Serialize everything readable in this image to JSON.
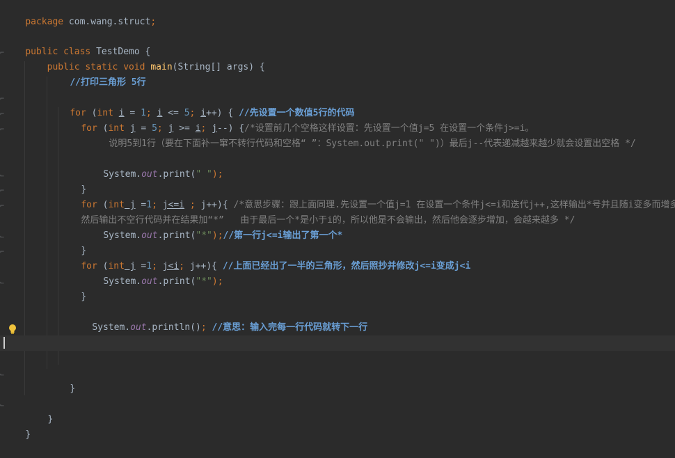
{
  "code": {
    "l1_package": "package",
    "l1_name": " com.wang.struct",
    "l1_semi": ";",
    "l3_public": "public",
    "l3_class": " class",
    "l3_name": " TestDemo {",
    "l4_indent": "    ",
    "l4_mods": "public static void",
    "l4_main": " main",
    "l4_args": "(String[] args) {",
    "l5_comment": "//打印三角形 5行",
    "l7_for": "for",
    "l7_a": " (",
    "l7_int": "int",
    "l7_i1": "i",
    "l7_eq": " = ",
    "l7_n1": "1",
    "l7_semi1": "; ",
    "l7_i2": "i",
    "l7_le": " <= ",
    "l7_n5": "5",
    "l7_semi2": "; ",
    "l7_i3": "i",
    "l7_inc": "++) { ",
    "l7_comment": "//先设置一个数值5行的代码",
    "l8_for": "for",
    "l8_a": " (",
    "l8_int": "int",
    "l8_j1": "j",
    "l8_eq": " = ",
    "l8_n5": "5",
    "l8_semi1": "; ",
    "l8_j2": "j",
    "l8_ge": " >= ",
    "l8_i": "i",
    "l8_semi2": "; ",
    "l8_j3": "j",
    "l8_dec": "--) {",
    "l8_comment": "/*设置前几个空格这样设置：先设置一个值j=5 在设置一个条件j>=i。",
    "l9_comment": "说明5到1行（要在下面补一窜不转行代码和空格“ ”：System.out.print(\" \")）最后j--代表递减越来越少就会设置出空格 */",
    "l11_sys": "System.",
    "l11_out": "out",
    "l11_print": ".print(",
    "l11_str": "\" \"",
    "l11_end": ");",
    "l12_brace": "}",
    "l13_for": "for",
    "l13_a": " (",
    "l13_int": "int",
    "l13_j1": " j",
    "l13_eq": " =",
    "l13_n1": "1",
    "l13_semi1": "; ",
    "l13_cond": "j<=i",
    "l13_semi2": " ; ",
    "l13_inc": "j++){ ",
    "l13_comment": "/*意思步骤：跟上面同理.先设置一个值j=1 在设置一个条件j<=i和迭代j++,这样输出*号并且随i变多而增多。",
    "l14_comment": "然后输出不空行代码并在结果加“*”   由于最后一个*是小于i的，所以他是不会输出，然后他会逐步增加，会越来越多 */",
    "l15_sys": "System.",
    "l15_out": "out",
    "l15_print": ".print(",
    "l15_str": "\"*\"",
    "l15_end": ");",
    "l15_comment": "//第一行j<=i输出了第一个*",
    "l16_brace": "}",
    "l17_for": "for",
    "l17_a": " (",
    "l17_int": "int",
    "l17_j1": " j",
    "l17_eq": " =",
    "l17_n1": "1",
    "l17_semi1": "; ",
    "l17_cond": "j<i",
    "l17_semi2": "; ",
    "l17_inc": "j++){ ",
    "l17_comment": "//上面已经出了一半的三角形，然后照抄并修改j<=i变成j<i",
    "l18_sys": "System.",
    "l18_out": "out",
    "l18_print": ".print(",
    "l18_str": "\"*\"",
    "l18_end": ");",
    "l19_brace": "}",
    "l21_sys": "System.",
    "l21_out": "out",
    "l21_println": ".println()",
    "l21_semi": "; ",
    "l21_comment": "//意思：输入完每一行代码就转下一行",
    "l25_brace": "}",
    "l27_brace": "}",
    "l28_brace": "}"
  },
  "colors": {
    "background": "#2b2b2b",
    "current_line": "#323232",
    "keyword": "#cc7832",
    "method": "#ffc66d",
    "number": "#6897bb",
    "string": "#6a8759",
    "field": "#9876aa",
    "comment": "#808080"
  },
  "icons": [
    "fold-marker-icon",
    "intention-bulb-icon",
    "text-caret-icon"
  ]
}
